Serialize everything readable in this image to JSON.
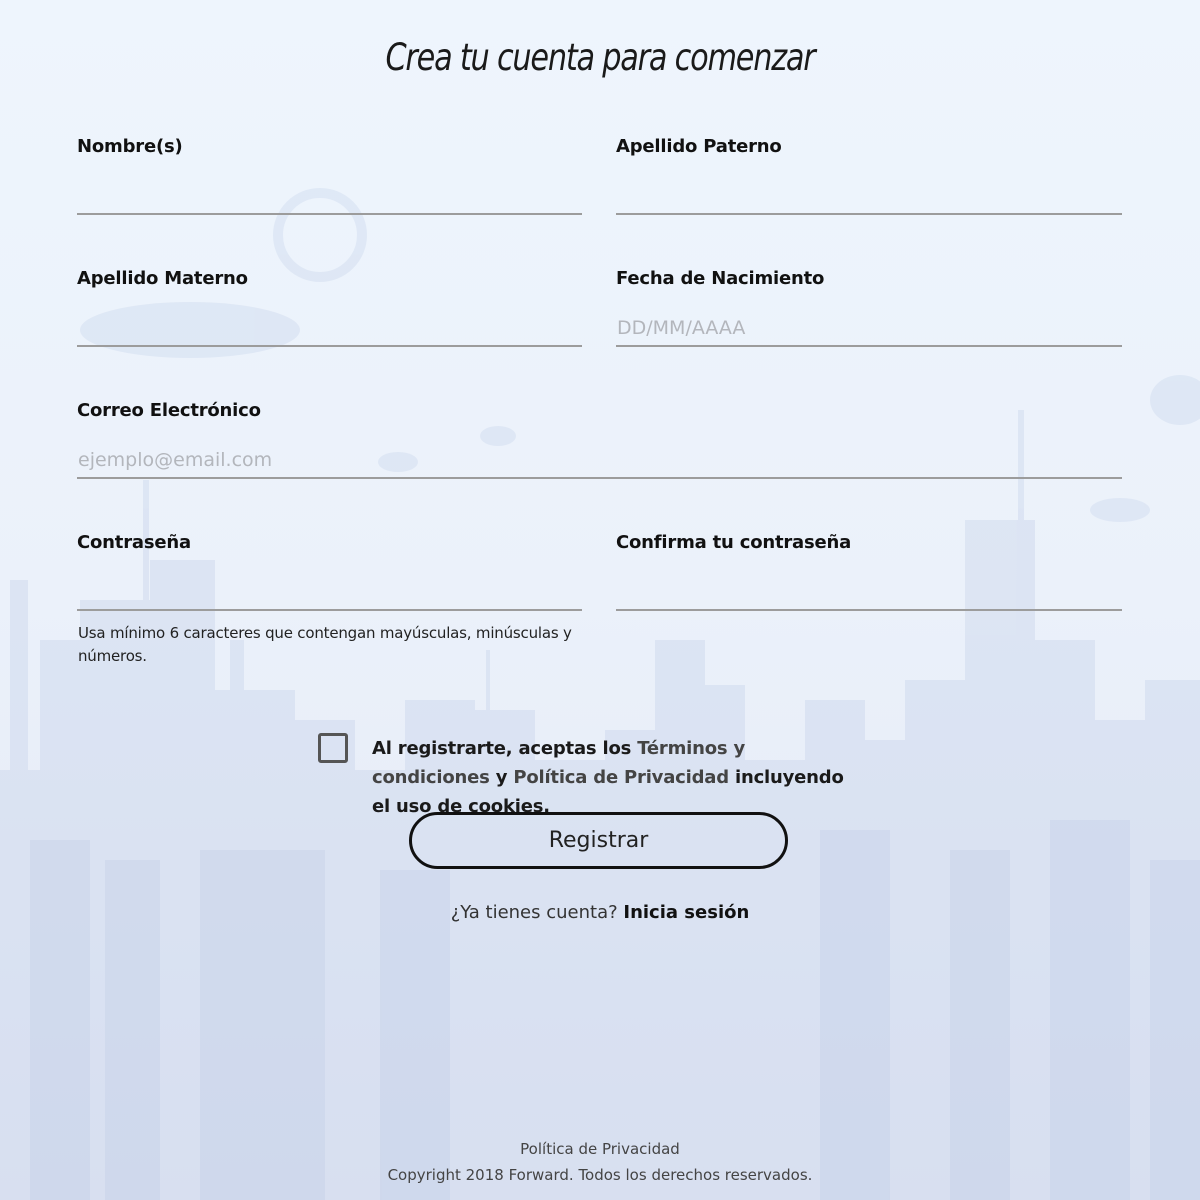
{
  "page": {
    "title": "Crea tu cuenta para comenzar"
  },
  "form": {
    "first_name": {
      "label": "Nombre(s)",
      "value": "",
      "placeholder": ""
    },
    "last_name_paternal": {
      "label": "Apellido Paterno",
      "value": "",
      "placeholder": ""
    },
    "last_name_maternal": {
      "label": "Apellido Materno",
      "value": "",
      "placeholder": ""
    },
    "birth_date": {
      "label": "Fecha de Nacimiento",
      "value": "",
      "placeholder": "DD/MM/AAAA"
    },
    "email": {
      "label": "Correo Electrónico",
      "value": "",
      "placeholder": "ejemplo@email.com"
    },
    "password": {
      "label": "Contraseña",
      "value": "",
      "placeholder": "",
      "hint": "Usa mínimo 6 caracteres que contengan mayúsculas, minúsculas y números."
    },
    "password_confirm": {
      "label": "Confirma tu contraseña",
      "value": "",
      "placeholder": ""
    }
  },
  "terms": {
    "checked": false,
    "prefix": "Al registrarte, aceptas los ",
    "terms_link": "Términos y condiciones",
    "conjunction": " y ",
    "privacy_link": "Política de Privacidad",
    "suffix": " incluyendo el uso de cookies."
  },
  "register_button": {
    "label": "Registrar"
  },
  "login_prompt": {
    "text": "¿Ya tienes cuenta? ",
    "link": "Inicia sesión"
  },
  "footer": {
    "privacy_link": "Política de Privacidad",
    "copyright": "Copyright 2018 Forward. Todos los derechos reservados."
  },
  "colors": {
    "background": "#e9eef8",
    "text": "#111111",
    "underline": "#9c9c9c",
    "placeholder": "#b3b6bc"
  }
}
